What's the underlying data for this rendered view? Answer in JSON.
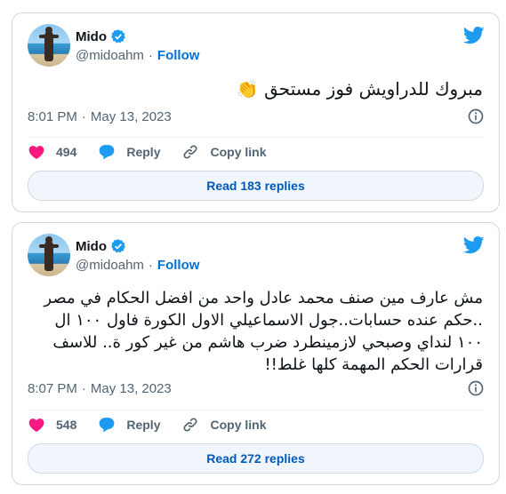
{
  "tweets": [
    {
      "name": "Mido",
      "handle": "@midoahm",
      "follow_label": "Follow",
      "text": "مبروك للدراويش فوز مستحق 👏",
      "time": "8:01 PM",
      "date": "May 13, 2023",
      "likes": "494",
      "reply_label": "Reply",
      "copy_label": "Copy link",
      "read_replies": "Read 183 replies"
    },
    {
      "name": "Mido",
      "handle": "@midoahm",
      "follow_label": "Follow",
      "text": "مش عارف مين صنف محمد عادل واحد من افضل الحكام في مصر ..حكم عنده حسابات..جول الاسماعيلي الاول الكورة فاول ١٠٠ ال ١٠٠ لنداي وصبحي لازمينطرد ضرب هاشم من غير كور ة.. للاسف قرارات الحكم المهمة كلها غلط!!",
      "time": "8:07 PM",
      "date": "May 13, 2023",
      "likes": "548",
      "reply_label": "Reply",
      "copy_label": "Copy link",
      "read_replies": "Read 272 replies"
    }
  ],
  "colors": {
    "like": "#f91880",
    "reply": "#1d9bf0",
    "follow": "#006fd6",
    "twitter": "#1d9bf0"
  },
  "icons": [
    "avatar",
    "verified-badge-icon",
    "twitter-bird-icon",
    "info-icon",
    "heart-icon",
    "reply-bubble-icon",
    "link-icon"
  ]
}
